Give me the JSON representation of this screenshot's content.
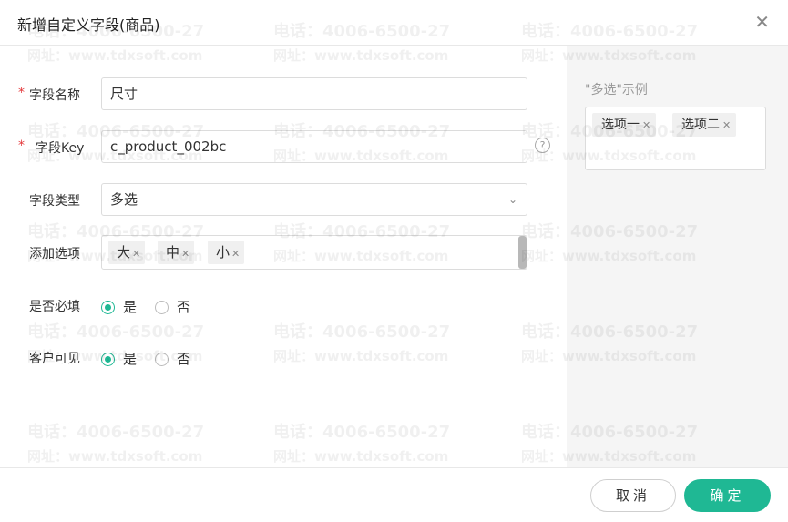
{
  "dialog": {
    "title": "新增自定义字段(商品)",
    "close_icon": "close-icon"
  },
  "form": {
    "field_name": {
      "label": "字段名称",
      "required_mark": "*",
      "value": "尺寸"
    },
    "field_key": {
      "label": "字段Key",
      "required_mark": "*",
      "value": "c_product_002bc",
      "help_icon": "question-circle-icon"
    },
    "field_type": {
      "label": "字段类型",
      "value": "多选",
      "arrow_icon": "chevron-down-icon"
    },
    "options": {
      "label": "添加选项",
      "tags": [
        "大",
        "中",
        "小"
      ]
    },
    "required": {
      "label": "是否必填",
      "yes": "是",
      "no": "否",
      "selected": "是"
    },
    "customer_visible": {
      "label": "客户可见",
      "yes": "是",
      "no": "否",
      "selected": "是"
    }
  },
  "example": {
    "title": "\"多选\"示例",
    "tags": [
      "选项一",
      "选项二"
    ]
  },
  "footer": {
    "cancel_label": "取消",
    "ok_label": "确定"
  },
  "watermark": {
    "phone": "电话：4006-6500-27",
    "url": "网址：www.tdxsoft.com"
  },
  "colors": {
    "accent": "#1fb894",
    "required": "#e4393c",
    "panel_bg": "#f5f5f5"
  }
}
